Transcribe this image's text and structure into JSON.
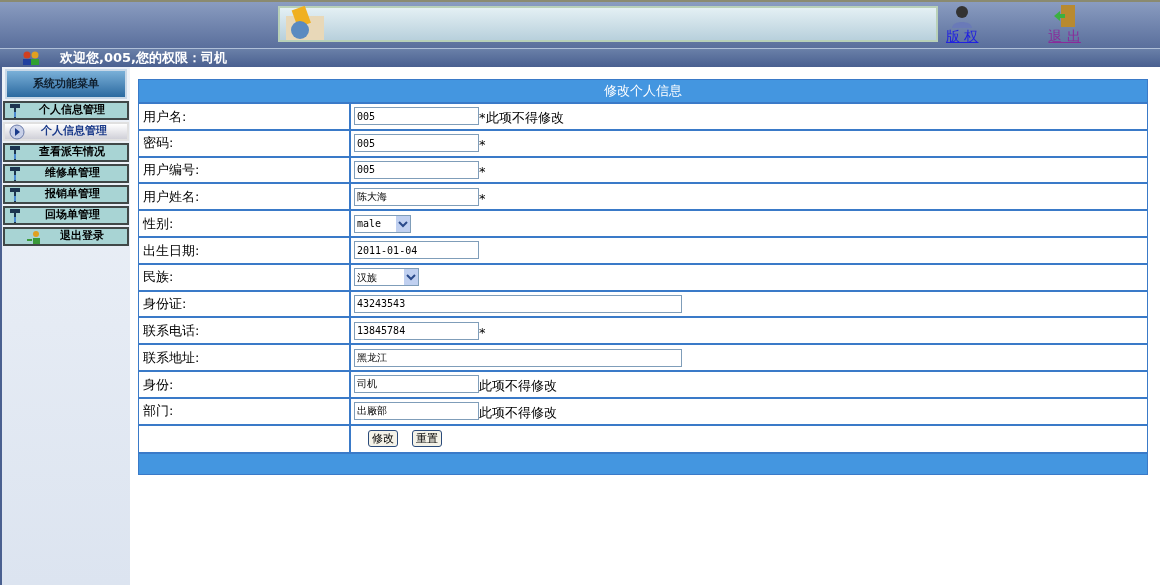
{
  "header": {
    "links": [
      "版 权",
      "退 出"
    ]
  },
  "welcome": "欢迎您,005,您的权限：司机",
  "sidebar": {
    "title": "系统功能菜单",
    "items": [
      {
        "label": "个人信息管理",
        "selected": false,
        "kind": "group"
      },
      {
        "label": "个人信息管理",
        "selected": true,
        "kind": "group"
      },
      {
        "label": "查看派车情况",
        "selected": false,
        "kind": "group"
      },
      {
        "label": "维修单管理",
        "selected": false,
        "kind": "group"
      },
      {
        "label": "报销单管理",
        "selected": false,
        "kind": "group"
      },
      {
        "label": "回场单管理",
        "selected": false,
        "kind": "group"
      },
      {
        "label": "退出登录",
        "selected": false,
        "kind": "logout"
      }
    ]
  },
  "form": {
    "title": "修改个人信息",
    "fields": [
      {
        "label": "用户名:",
        "kind": "input",
        "value": "005",
        "wide": false,
        "note": "*此项不得修改"
      },
      {
        "label": "密码:",
        "kind": "input",
        "value": "005",
        "wide": false,
        "note": "*"
      },
      {
        "label": "用户编号:",
        "kind": "input",
        "value": "005",
        "wide": false,
        "note": "*"
      },
      {
        "label": "用户姓名:",
        "kind": "input",
        "value": "陈大海",
        "wide": false,
        "note": "*"
      },
      {
        "label": "性别:",
        "kind": "select",
        "value": "male",
        "wide": false
      },
      {
        "label": "出生日期:",
        "kind": "input",
        "value": "2011-01-04",
        "wide": false
      },
      {
        "label": "民族:",
        "kind": "select",
        "value": "汉族",
        "wide": true
      },
      {
        "label": "身份证:",
        "kind": "input",
        "value": "43243543",
        "wide": true
      },
      {
        "label": "联系电话:",
        "kind": "input",
        "value": "13845784",
        "wide": false,
        "note": "*"
      },
      {
        "label": "联系地址:",
        "kind": "input",
        "value": "黑龙江",
        "wide": true
      },
      {
        "label": "身份:",
        "kind": "input",
        "value": "司机",
        "wide": false,
        "note": "此项不得修改"
      },
      {
        "label": "部门:",
        "kind": "input",
        "value": "出厰部",
        "wide": false,
        "note": "此项不得修改"
      }
    ],
    "buttons": [
      "修改",
      "重置"
    ]
  }
}
